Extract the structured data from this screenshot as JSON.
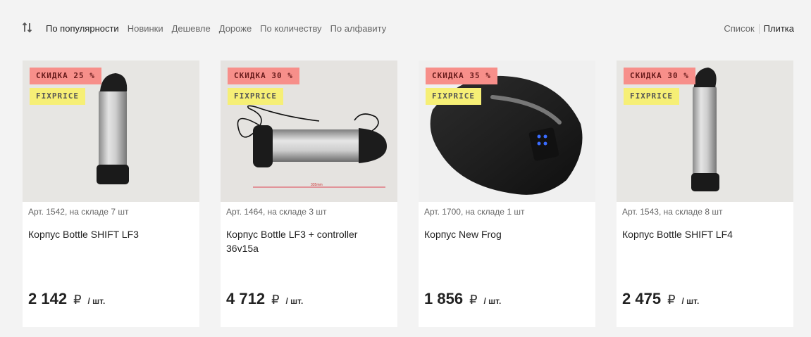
{
  "sort": {
    "options": [
      "По популярности",
      "Новинки",
      "Дешевле",
      "Дороже",
      "По количеству",
      "По алфавиту"
    ],
    "active_index": 0
  },
  "view": {
    "list_label": "Список",
    "grid_label": "Плитка",
    "active": "grid"
  },
  "products": [
    {
      "discount": "СКИДКА 25 %",
      "tag": "FIXPRICE",
      "art": "Арт. 1542, на складе 7 шт",
      "title": "Корпус Bottle SHIFT LF3",
      "price": "2 142",
      "currency": "₽",
      "unit": "/ шт."
    },
    {
      "discount": "СКИДКА 30 %",
      "tag": "FIXPRICE",
      "art": "Арт. 1464, на складе 3 шт",
      "title": "Корпус Bottle LF3 + controller 36v15a",
      "price": "4 712",
      "currency": "₽",
      "unit": "/ шт."
    },
    {
      "discount": "СКИДКА 35 %",
      "tag": "FIXPRICE",
      "art": "Арт. 1700, на складе 1 шт",
      "title": "Корпус New Frog",
      "price": "1 856",
      "currency": "₽",
      "unit": "/ шт."
    },
    {
      "discount": "СКИДКА 30 %",
      "tag": "FIXPRICE",
      "art": "Арт. 1543, на складе 8 шт",
      "title": "Корпус Bottle SHIFT LF4",
      "price": "2 475",
      "currency": "₽",
      "unit": "/ шт."
    }
  ],
  "colors": {
    "discount_badge": "#f78f8a",
    "fix_badge": "#f6ef76",
    "background": "#f3f3f3"
  },
  "icons": {
    "sort": "sort-arrows-icon"
  }
}
